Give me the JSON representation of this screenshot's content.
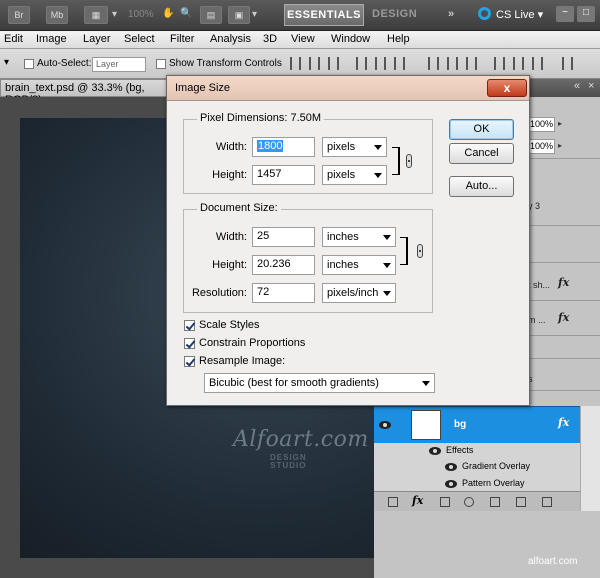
{
  "appbar": {
    "br": "Br",
    "mb": "Mb",
    "zoom": "100%",
    "essentials": "ESSENTIALS",
    "design": "DESIGN",
    "more": "»",
    "cs_live": "CS Live"
  },
  "menu": [
    "Edit",
    "Image",
    "Layer",
    "Select",
    "Filter",
    "Analysis",
    "3D",
    "View",
    "Window",
    "Help"
  ],
  "options": {
    "auto_select": "Auto-Select:",
    "auto_select_value": "Layer",
    "show_transform": "Show Transform Controls"
  },
  "document": {
    "tab_title": "brain_text.psd @ 33.3% (bg, RGB/8)"
  },
  "panel": {
    "opacity_1": "100%",
    "opacity_2": "100%",
    "text_layer": "y 3",
    "layer_a": "t sh...",
    "layer_b": "m ...",
    "layer_c": "s",
    "fx": "fx",
    "bg_layer": "bg",
    "effects": "Effects",
    "effect_1": "Gradient Overlay",
    "effect_2": "Pattern Overlay"
  },
  "canvas": {
    "logo": "Alfoart.com",
    "logo_sub_1": "DESIGN",
    "logo_sub_2": "STUDIO"
  },
  "credit": "alfoart.com",
  "dialog": {
    "title": "Image Size",
    "close": "x",
    "pixel_dimensions_label": "Pixel Dimensions:",
    "pixel_dimensions_value": "7.50M",
    "width_label": "Width:",
    "width_value": "1800",
    "width_unit": "pixels",
    "height_label": "Height:",
    "height_value": "1457",
    "height_unit": "pixels",
    "document_size_label": "Document Size:",
    "doc_width_label": "Width:",
    "doc_width_value": "25",
    "doc_width_unit": "inches",
    "doc_height_label": "Height:",
    "doc_height_value": "20.236",
    "doc_height_unit": "inches",
    "resolution_label": "Resolution:",
    "resolution_value": "72",
    "resolution_unit": "pixels/inch",
    "scale_styles": "Scale Styles",
    "constrain_proportions": "Constrain Proportions",
    "resample_image": "Resample Image:",
    "resample_method": "Bicubic (best for smooth gradients)",
    "ok": "OK",
    "cancel": "Cancel",
    "auto": "Auto..."
  }
}
